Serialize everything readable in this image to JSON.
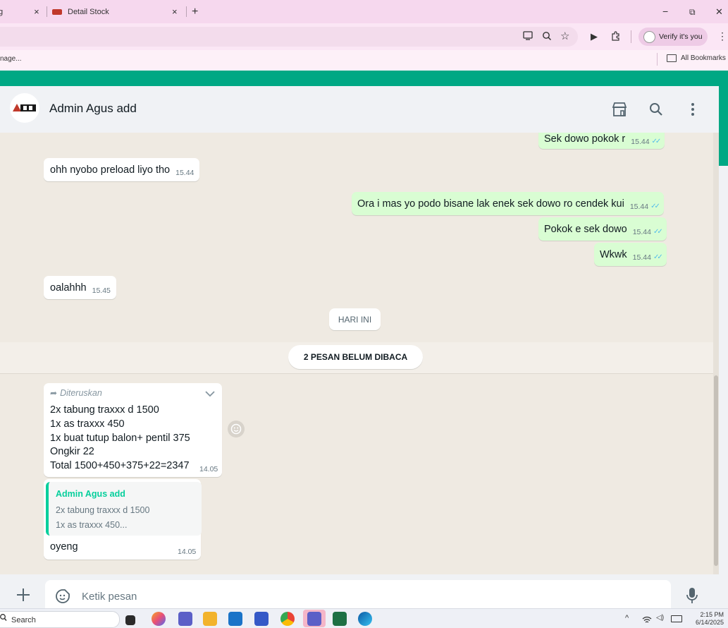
{
  "browser": {
    "tab_left_label": "g",
    "tab_close": "×",
    "tab_active_label": "Detail Stock",
    "new_tab": "+",
    "win_min": "−",
    "win_restore": "⧉",
    "win_close": "✕",
    "verify_label": "Verify it's you",
    "bookmark_left": "nage...",
    "all_bookmarks": "All Bookmarks"
  },
  "chat": {
    "contact_name": "Admin Agus add",
    "messages": [
      {
        "dir": "out",
        "text": "Sek dowo pokok r",
        "time": "15.44"
      },
      {
        "dir": "in",
        "text": "ohh nyobo preload liyo tho",
        "time": "15.44"
      },
      {
        "dir": "out",
        "text": "Ora i mas yo podo bisane lak enek sek dowo ro cendek kui",
        "time": "15.44"
      },
      {
        "dir": "out",
        "text": "Pokok e sek dowo",
        "time": "15.44"
      },
      {
        "dir": "out",
        "text": "Wkwk",
        "time": "15.44"
      },
      {
        "dir": "in",
        "text": "oalahhh",
        "time": "15.45"
      }
    ],
    "day_divider": "HARI INI",
    "unread_divider": "2 PESAN BELUM DIBACA",
    "forwarded": {
      "label": "Diteruskan",
      "lines": [
        "2x tabung traxxx d 1500",
        "1x as traxxx 450",
        "1x buat tutup balon+ pentil 375",
        "Ongkir 22",
        "Total 1500+450+375+22=2347"
      ],
      "time": "14.05"
    },
    "reply": {
      "quote_author": "Admin Agus add",
      "quote_line1": "2x tabung traxxx d 1500",
      "quote_line2": "1x as traxxx 450...",
      "text": "oyeng",
      "time": "14.05"
    },
    "input_placeholder": "Ketik pesan"
  },
  "taskbar": {
    "search_label": "Search",
    "time": "2:15 PM",
    "date": "6/14/2025"
  },
  "colors": {
    "accent": "#00a884",
    "outgoing": "#d9fdd3",
    "incoming": "#ffffff",
    "read_tick": "#53bdeb"
  }
}
